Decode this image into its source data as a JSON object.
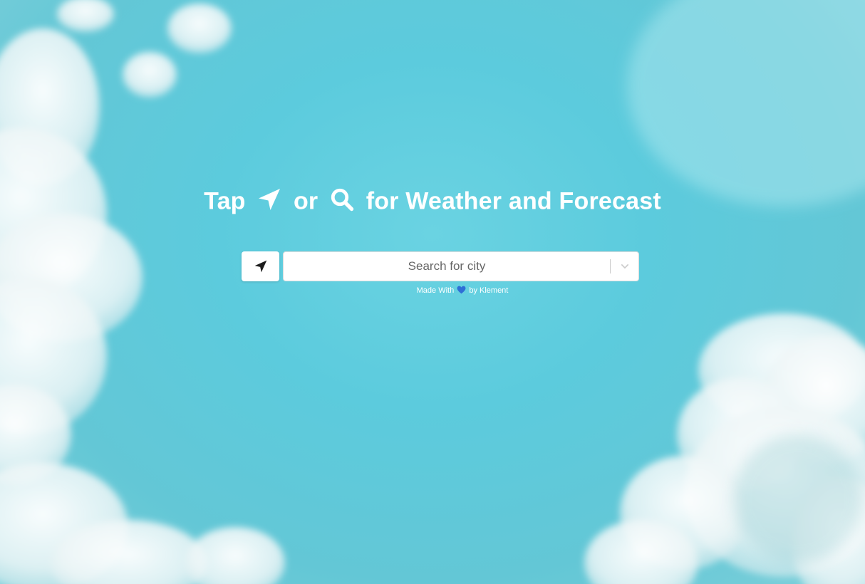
{
  "headline": {
    "prefix": "Tap",
    "middle": "or",
    "suffix": "for Weather and Forecast",
    "icons": [
      "location-arrow-icon",
      "magnifier-icon"
    ]
  },
  "location_button": {
    "icon": "location-arrow-icon"
  },
  "search": {
    "placeholder": "Search for city",
    "value": "",
    "dropdown_icon": "chevron-down-icon"
  },
  "credit": {
    "prefix": "Made With",
    "heart_icon": "blue-heart-icon",
    "suffix": "by Klement"
  },
  "colors": {
    "sky": "#5ccbdd",
    "text": "#ffffff",
    "icon_dark": "#1d1d1d",
    "heart": "#2f6fd6"
  }
}
